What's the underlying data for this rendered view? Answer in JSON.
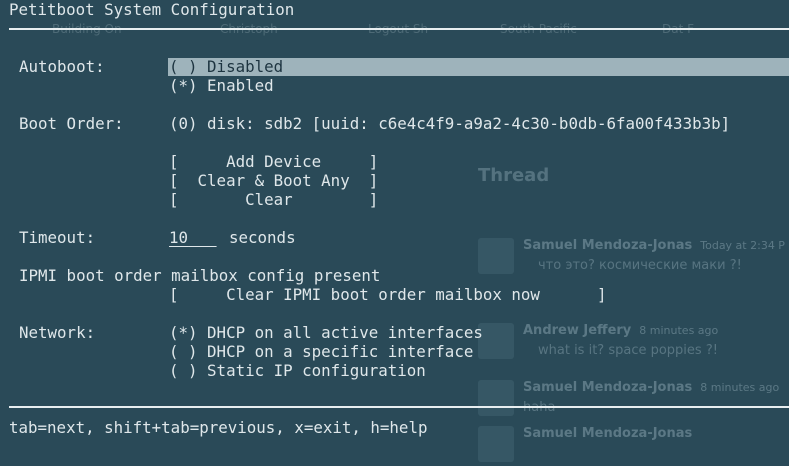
{
  "window": {
    "title": "Petitboot System Configuration"
  },
  "autoboot": {
    "label": "Autoboot:",
    "options": [
      "( ) Disabled",
      "(*) Enabled"
    ],
    "selected_index": 1,
    "focused_index": 0
  },
  "boot_order": {
    "label": "Boot Order:",
    "entries": [
      "(0) disk: sdb2 [uuid: c6e4c4f9-a9a2-4c30-b0db-6fa00f433b3b]"
    ],
    "buttons": [
      "[     Add Device     ]",
      "[  Clear & Boot Any  ]",
      "[       Clear        ]"
    ]
  },
  "timeout": {
    "label": "Timeout:",
    "value": "10",
    "unit": "seconds"
  },
  "ipmi": {
    "message": "IPMI boot order mailbox config present",
    "button": "[     Clear IPMI boot order mailbox now      ]"
  },
  "network": {
    "label": "Network:",
    "options": [
      "(*) DHCP on all active interfaces",
      "( ) DHCP on a specific interface",
      "( ) Static IP configuration"
    ],
    "selected_index": 0
  },
  "footer": {
    "help": "tab=next, shift+tab=previous, x=exit, h=help"
  },
  "background_window": {
    "tabs": [
      "Building On",
      "Christoph",
      "Logout  Sh",
      "South Pacific",
      "Dat F"
    ],
    "thread_title": "Thread",
    "messages": [
      {
        "author": "Samuel Mendoza-Jonas",
        "time": "Today at 2:34 P",
        "text": "что это? космические маки ?!"
      },
      {
        "author": "Andrew Jeffery",
        "time": "8 minutes ago",
        "text": "what is it? space poppies ?!"
      },
      {
        "author": "Samuel Mendoza-Jonas",
        "time": "8 minutes ago",
        "text": "haha"
      },
      {
        "author": "Samuel Mendoza-Jonas",
        "time": "",
        "text": ""
      }
    ]
  },
  "colors": {
    "background": "#2a4a58",
    "foreground": "#dfe7ea",
    "highlight": "#9eb3bb"
  }
}
